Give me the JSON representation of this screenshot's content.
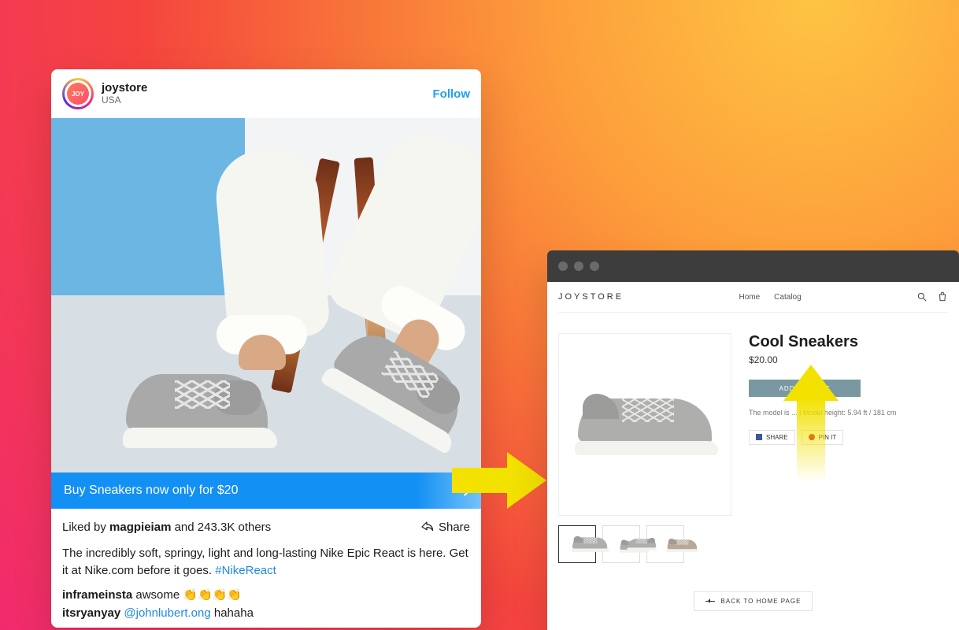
{
  "colors": {
    "cta_blue": "#1390f4",
    "link_blue": "#1f8ae0",
    "addcart_teal": "#7a98a1",
    "arrow_yellow": "#f3e100"
  },
  "insta": {
    "avatar_text": "JOY",
    "username": "joystore",
    "location": "USA",
    "follow_label": "Follow",
    "cta_text": "Buy Sneakers now only for $20",
    "liked_prefix": "Liked by ",
    "liked_user": "magpieiam",
    "liked_suffix": " and 243.3K others",
    "share_label": "Share",
    "caption_text": "The incredibly soft, springy, light and long-lasting Nike Epic React is here. Get it at Nike.com before it goes. ",
    "caption_hashtag": "#NikeReact",
    "comments": [
      {
        "user": "inframeinsta",
        "text": " awsome 👏👏👏👏"
      },
      {
        "user": "itsryanyay",
        "mention": "@johnlubert.ong",
        "text": " hahaha"
      }
    ]
  },
  "store": {
    "brand": "JOYSTORE",
    "nav": {
      "home": "Home",
      "catalog": "Catalog"
    },
    "product": {
      "title": "Cool Sneakers",
      "price": "$20.00",
      "add_to_cart": "ADD TO CART",
      "description": "The model is ... | Model height: 5.94 ft / 181 cm"
    },
    "share": {
      "fb": "SHARE",
      "pin": "PIN IT"
    },
    "back_home": "BACK TO HOME PAGE"
  }
}
